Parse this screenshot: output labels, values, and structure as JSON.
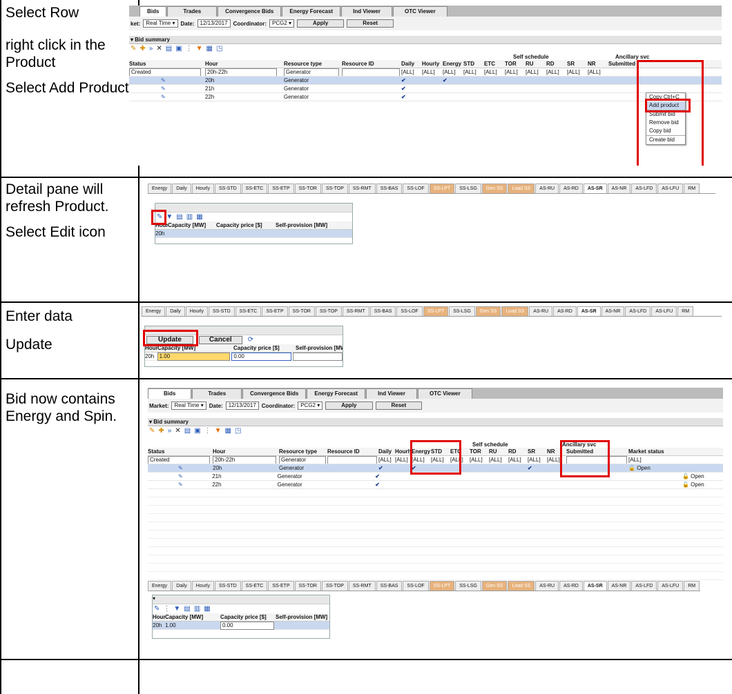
{
  "steps": [
    {
      "lines": [
        "Select  Row",
        "right click in the Product",
        "Select Add Product."
      ]
    },
    {
      "lines": [
        "Detail pane will refresh Product.",
        "Select Edit icon"
      ]
    },
    {
      "lines": [
        "Enter data",
        "Update"
      ]
    },
    {
      "lines": [
        "Bid now contains Energy  and Spin."
      ]
    }
  ],
  "app": {
    "tabs": [
      "Bids",
      "Trades",
      "Convergence Bids",
      "Energy Forecast",
      "Ind Viewer",
      "OTC Viewer"
    ],
    "market_label": "Market:",
    "market_label_cropped": "ket:",
    "market_value": "Real Time",
    "date_label": "Date:",
    "date_value": "12/13/2017",
    "coordinator_label": "Coordinator:",
    "coordinator_value": "PCG2",
    "apply": "Apply",
    "reset": "Reset",
    "section": "Bid summary",
    "group_self": "Self schedule",
    "group_anc": "Ancillary svc",
    "cols": [
      "Status",
      "Hour",
      "Resource type",
      "Resource ID",
      "Daily",
      "Hourly",
      "Energy",
      "STD",
      "ETC",
      "TOR",
      "RU",
      "RD",
      "SR",
      "NR",
      "Submitted",
      "Market status"
    ],
    "filter_status": "Created",
    "filter_hour": "20h-22h",
    "filter_type": "Generator",
    "all": "[ALL]",
    "rows": [
      {
        "hour": "20h",
        "type": "Generator",
        "market": "Open"
      },
      {
        "hour": "21h",
        "type": "Generator",
        "market": "Open"
      },
      {
        "hour": "22h",
        "type": "Generator",
        "market": "Open"
      }
    ],
    "check": "✔",
    "context_menu": [
      "Copy Ctrl+C",
      "Add product",
      "Submit bid",
      "Remove bid",
      "Copy bid",
      "Create bid"
    ]
  },
  "detail": {
    "tabs": [
      "Energy",
      "Daily",
      "Hourly",
      "SS-STD",
      "SS-ETC",
      "SS-ETP",
      "SS-TOR",
      "SS-TOP",
      "SS-RMT",
      "SS-BAS",
      "SS-LOF",
      "SS-LPT",
      "SS-LSG",
      "Gen SS",
      "Load SS",
      "AS-RU",
      "AS-RD",
      "AS-SR",
      "AS-NR",
      "AS-LFD",
      "AS-LFU",
      "RM"
    ],
    "cols": [
      "Hour",
      "Capacity [MW]",
      "Capacity price [$]",
      "Self-provision [MW]"
    ],
    "hour": "20h",
    "capacity": "1.00",
    "price": "0.00",
    "update": "Update",
    "cancel": "Cancel"
  },
  "colors": {
    "highlight": "#e00000",
    "orange_tab": "#e7b27c",
    "selected_row": "#c9d8ef"
  }
}
